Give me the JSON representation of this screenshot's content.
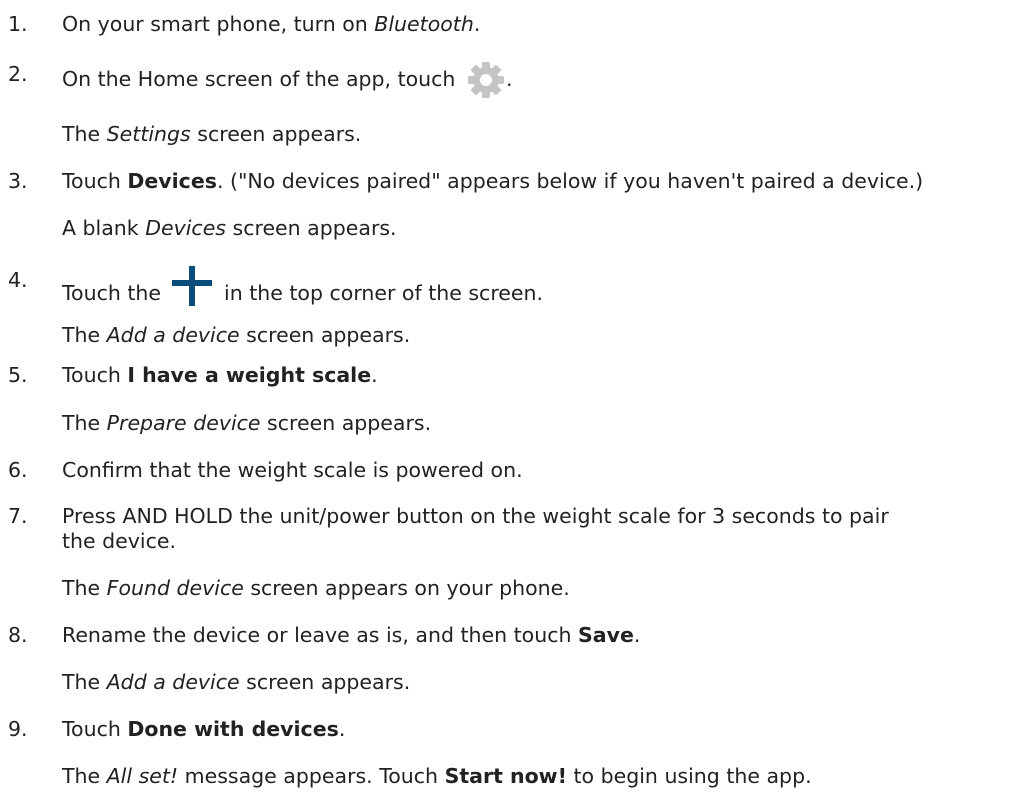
{
  "steps": [
    {
      "num": "1.",
      "text_before": "On your smart phone, turn on ",
      "em": "Bluetooth",
      "text_after": "."
    },
    {
      "num": "2.",
      "text_before": "On the Home screen of the app, touch ",
      "icon": "gear-icon",
      "text_after": ".",
      "result_before": "The ",
      "result_em": "Settings",
      "result_after": " screen appears."
    },
    {
      "num": "3.",
      "text_before": "Touch ",
      "bold": "Devices",
      "text_after": ". (\"No devices paired\" appears below if you haven't paired a device.)",
      "result_before": "A blank ",
      "result_em": "Devices",
      "result_after": " screen appears."
    },
    {
      "num": "4.",
      "text_before": "Touch the ",
      "icon": "plus-icon",
      "text_after": " in the top corner of the screen.",
      "result_before": "The ",
      "result_em": "Add a device",
      "result_after": " screen appears."
    },
    {
      "num": "5.",
      "text_before": "Touch ",
      "bold": "I have a weight scale",
      "text_after": ".",
      "result_before": "The ",
      "result_em": "Prepare device",
      "result_after": " screen appears."
    },
    {
      "num": "6.",
      "text_before": "Confirm that the weight scale is powered on."
    },
    {
      "num": "7.",
      "text_before": "Press AND HOLD the unit/power button on the weight scale for 3 seconds to pair",
      "text_line2": "the device.",
      "result_before": "The ",
      "result_em": "Found device",
      "result_after": " screen appears on your phone."
    },
    {
      "num": "8.",
      "text_before": "Rename the device or leave as is, and then touch ",
      "bold": "Save",
      "text_after": ".",
      "result_before": "The ",
      "result_em": "Add a device",
      "result_after": " screen appears."
    },
    {
      "num": "9.",
      "text_before": "Touch ",
      "bold": "Done with devices",
      "text_after": ".",
      "result_before": "The ",
      "result_em": "All set!",
      "result_after": " message appears. Touch ",
      "result_bold": "Start now!",
      "result_after2": " to begin using the app."
    }
  ],
  "colors": {
    "text": "#222222",
    "gear_icon": "#c4c4c4",
    "plus_icon": "#0a4d7a"
  }
}
